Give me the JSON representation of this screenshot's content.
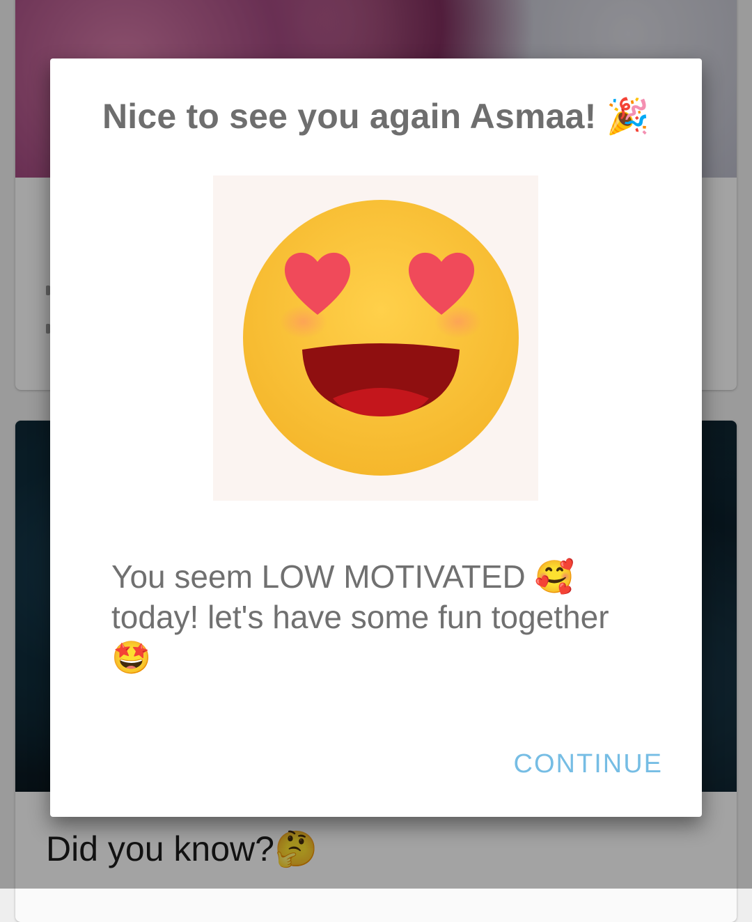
{
  "dialog": {
    "title": "Nice to see you again Asmaa! 🎉",
    "message": "You seem LOW MOTIVATED 🥰 today! let's have some fun together 🤩",
    "continue_label": "CONTINUE",
    "image_icon": "heart-eyes-smiley-icon"
  },
  "feed": {
    "card_2_title": "Did you know?🤔"
  },
  "colors": {
    "dialog_title": "#6e6e6e",
    "message_text": "#707070",
    "accent": "#76bde4",
    "smiley_yellow": "#f7c93e",
    "heart_red": "#f04a5a"
  }
}
